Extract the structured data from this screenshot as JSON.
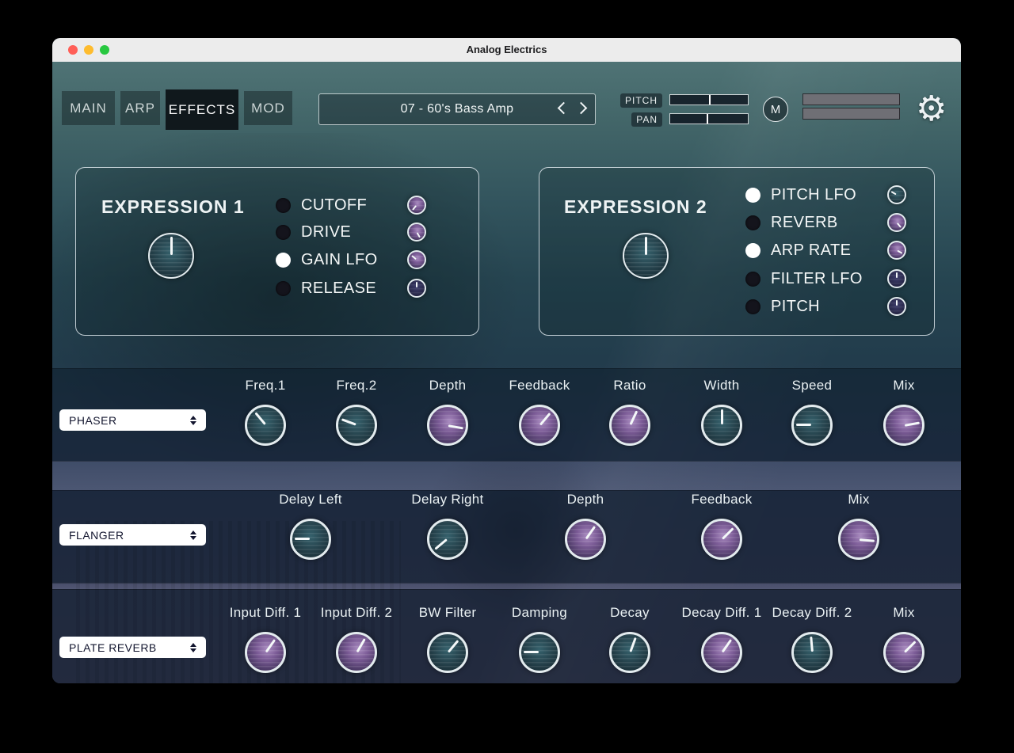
{
  "window": {
    "title": "Analog Electrics"
  },
  "colors": {
    "traffic_close": "#ff5f57",
    "traffic_minimize": "#febc2e",
    "traffic_zoom": "#28c840",
    "tab_active_bg": "#10181c",
    "knob_teal": "#2c535e",
    "knob_purple": "#7b5b96",
    "knob_indigo": "#2e2e52",
    "selector_bg": "#ffffff",
    "selector_text": "#12152e"
  },
  "icons": {
    "settings": "⚙"
  },
  "nav": {
    "tabs": [
      {
        "label": "MAIN",
        "active": false
      },
      {
        "label": "ARP",
        "active": false
      },
      {
        "label": "EFFECTS",
        "active": true
      },
      {
        "label": "MOD",
        "active": false
      }
    ],
    "preset": {
      "value": "07 - 60's Bass Amp"
    },
    "pitch": {
      "label": "PITCH",
      "position_pct": 50
    },
    "pan": {
      "label": "PAN",
      "position_pct": 47
    },
    "mono_button_label": "M"
  },
  "expressions": [
    {
      "title": "EXPRESSION 1",
      "knob": {
        "variant": "teal",
        "angle": 0
      },
      "options": [
        {
          "label": "CUTOFF",
          "selected": false,
          "knob": {
            "variant": "purple",
            "angle": -140
          }
        },
        {
          "label": "DRIVE",
          "selected": false,
          "knob": {
            "variant": "purple",
            "angle": 150
          }
        },
        {
          "label": "GAIN LFO",
          "selected": true,
          "knob": {
            "variant": "purple",
            "angle": -50
          }
        },
        {
          "label": "RELEASE",
          "selected": false,
          "knob": {
            "variant": "indigo",
            "angle": 0
          }
        }
      ]
    },
    {
      "title": "EXPRESSION 2",
      "knob": {
        "variant": "teal",
        "angle": 0
      },
      "options": [
        {
          "label": "PITCH LFO",
          "selected": true,
          "knob": {
            "variant": "teal",
            "angle": -60
          }
        },
        {
          "label": "REVERB",
          "selected": false,
          "knob": {
            "variant": "purple",
            "angle": 140
          }
        },
        {
          "label": "ARP RATE",
          "selected": true,
          "knob": {
            "variant": "purple",
            "angle": 120
          }
        },
        {
          "label": "FILTER LFO",
          "selected": false,
          "knob": {
            "variant": "indigo",
            "angle": 0
          }
        },
        {
          "label": "PITCH",
          "selected": false,
          "knob": {
            "variant": "indigo",
            "angle": 0
          }
        }
      ]
    }
  ],
  "effects": [
    {
      "selector": "PHASER",
      "knobs": [
        {
          "label": "Freq.1",
          "variant": "teal",
          "angle": -40
        },
        {
          "label": "Freq.2",
          "variant": "teal",
          "angle": -70
        },
        {
          "label": "Depth",
          "variant": "purple",
          "angle": 100
        },
        {
          "label": "Feedback",
          "variant": "purple",
          "angle": 40
        },
        {
          "label": "Ratio",
          "variant": "purple",
          "angle": 25
        },
        {
          "label": "Width",
          "variant": "teal",
          "angle": 0
        },
        {
          "label": "Speed",
          "variant": "teal",
          "angle": -90
        },
        {
          "label": "Mix",
          "variant": "purple",
          "angle": 80
        }
      ]
    },
    {
      "selector": "FLANGER",
      "knobs": [
        {
          "label": "Delay Left",
          "variant": "teal",
          "angle": -90
        },
        {
          "label": "Delay Right",
          "variant": "teal",
          "angle": -130
        },
        {
          "label": "Depth",
          "variant": "purple",
          "angle": 35
        },
        {
          "label": "Feedback",
          "variant": "purple",
          "angle": 45
        },
        {
          "label": "Mix",
          "variant": "purple",
          "angle": 95
        }
      ]
    },
    {
      "selector": "PLATE REVERB",
      "knobs": [
        {
          "label": "Input Diff. 1",
          "variant": "purple",
          "angle": 35
        },
        {
          "label": "Input Diff. 2",
          "variant": "purple",
          "angle": 30
        },
        {
          "label": "BW Filter",
          "variant": "teal",
          "angle": 40
        },
        {
          "label": "Damping",
          "variant": "teal",
          "angle": -90
        },
        {
          "label": "Decay",
          "variant": "teal",
          "angle": 20
        },
        {
          "label": "Decay Diff. 1",
          "variant": "purple",
          "angle": 35
        },
        {
          "label": "Decay Diff. 2",
          "variant": "teal",
          "angle": -5
        },
        {
          "label": "Mix",
          "variant": "purple",
          "angle": 45
        }
      ]
    }
  ]
}
